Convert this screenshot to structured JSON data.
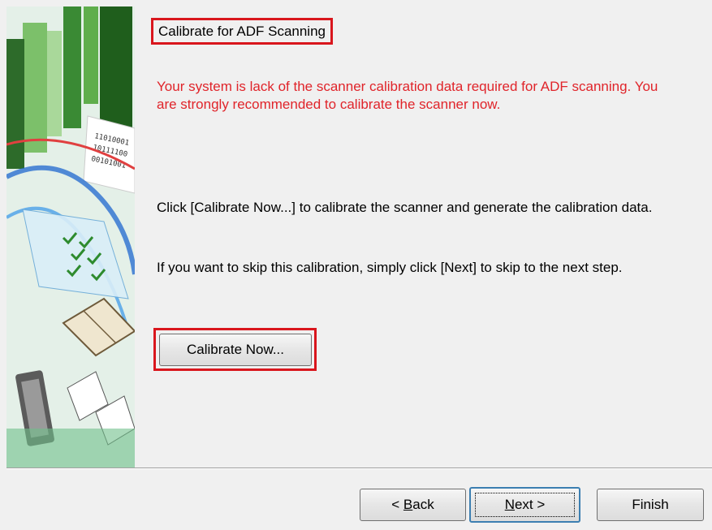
{
  "page": {
    "title": "Calibrate for ADF Scanning",
    "warning": "Your system is lack of the scanner calibration data required for ADF scanning.  You are strongly recommended to calibrate the scanner now.",
    "instruction": "Click [Calibrate Now...] to calibrate the scanner and generate the calibration data.",
    "skip_hint": "If you want to skip this calibration, simply click [Next] to skip to the next step.",
    "calibrate_button": "Calibrate Now..."
  },
  "footer": {
    "back": {
      "prefix": "< ",
      "mnemonic": "B",
      "rest": "ack"
    },
    "next": {
      "mnemonic": "N",
      "rest": "ext >"
    },
    "finish": "Finish"
  },
  "side_graphic": {
    "binary_lines": [
      "11010001",
      "10111100",
      "00101001"
    ]
  },
  "colors": {
    "highlight": "#d9161d",
    "warning_text": "#e0242a",
    "background": "#f0f0f0"
  }
}
